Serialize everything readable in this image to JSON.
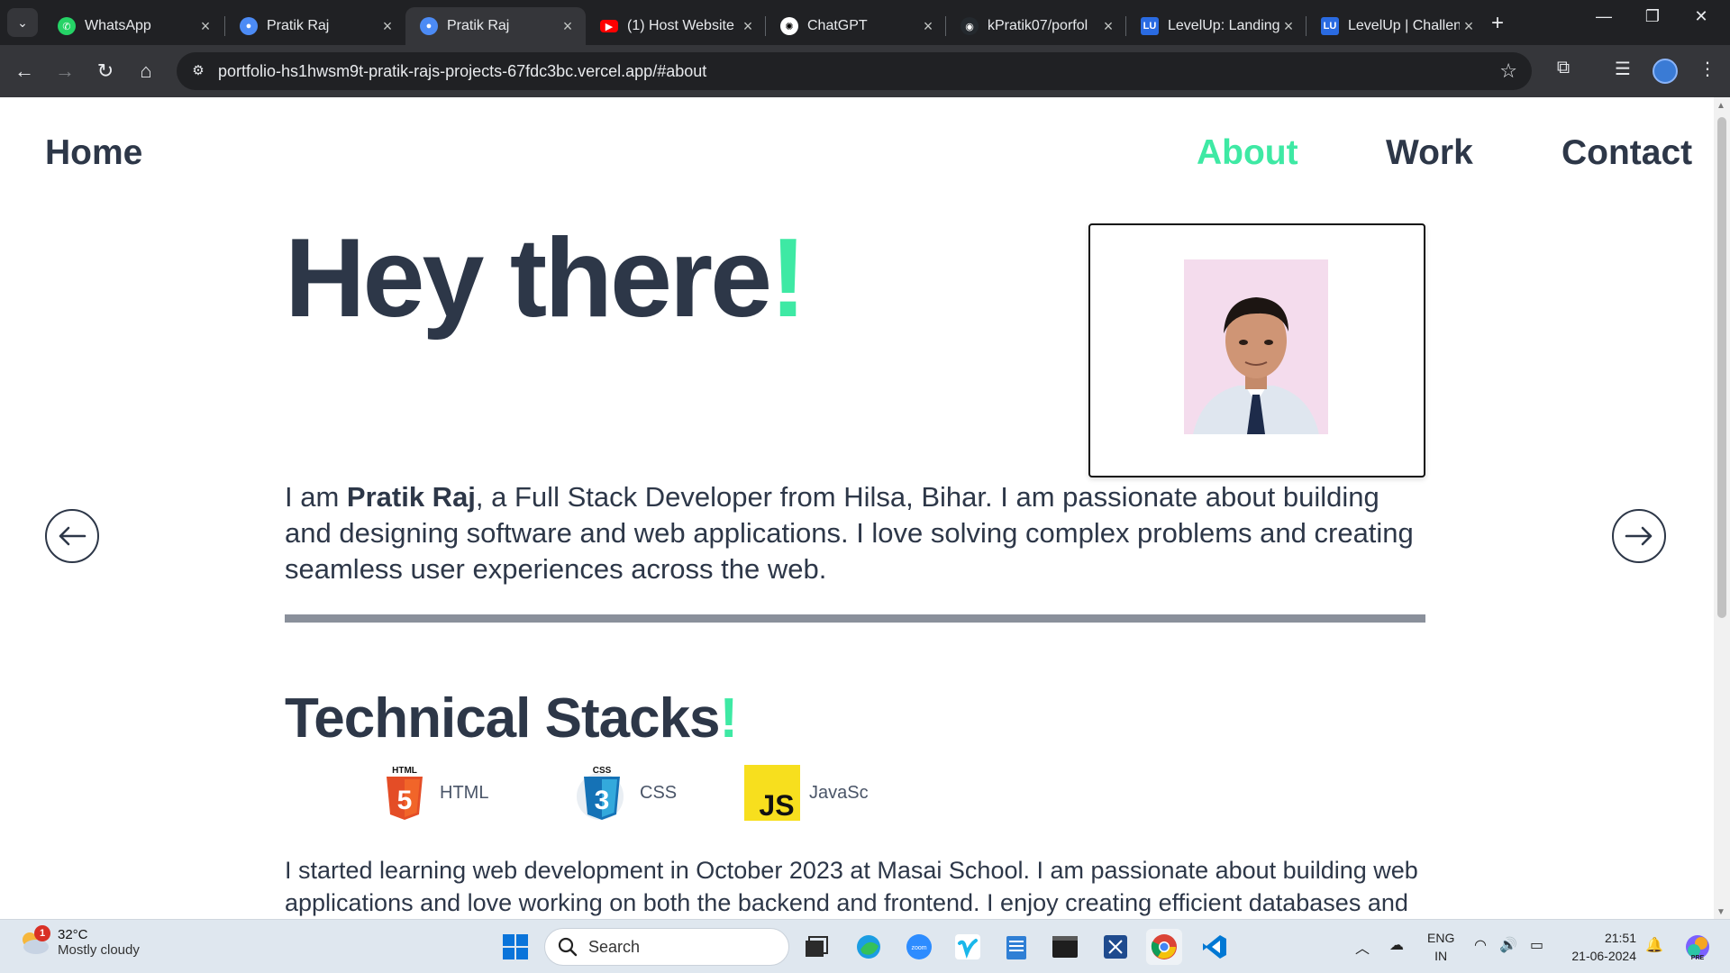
{
  "browser": {
    "tabs": [
      {
        "title": "WhatsApp",
        "icon": "whatsapp-icon",
        "active": false
      },
      {
        "title": "Pratik Raj",
        "icon": "user-icon",
        "active": false
      },
      {
        "title": "Pratik Raj",
        "icon": "user-icon",
        "active": true
      },
      {
        "title": "(1) Host Website",
        "icon": "youtube-icon",
        "active": false
      },
      {
        "title": "ChatGPT",
        "icon": "chatgpt-icon",
        "active": false
      },
      {
        "title": "kPratik07/porfol",
        "icon": "github-icon",
        "active": false
      },
      {
        "title": "LevelUp: Landing",
        "icon": "levelup-icon",
        "active": false
      },
      {
        "title": "LevelUp | Challen",
        "icon": "levelup-icon",
        "active": false
      }
    ],
    "url": "portfolio-hs1hwsm9t-pratik-rajs-projects-67fdc3bc.vercel.app/#about",
    "levelup_badge": "LU"
  },
  "site": {
    "nav": {
      "home": "Home",
      "about": "About",
      "work": "Work",
      "contact": "Contact",
      "active": "About"
    },
    "hero": {
      "title": "Hey there",
      "accent": "!"
    },
    "intro": {
      "prefix": "I am ",
      "name": "Pratik Raj",
      "text": ", a Full Stack Developer from Hilsa, Bihar. I am passionate about building and designing software and web applications. I love solving complex problems and creating seamless user experiences across the web."
    },
    "stacks": {
      "title": "Technical Stacks",
      "accent": "!",
      "items": [
        {
          "label": "HTML",
          "badge": "HTML",
          "glyph": "5",
          "icon": "html5-icon",
          "color": "#e44d26"
        },
        {
          "label": "CSS",
          "badge": "CSS",
          "glyph": "3",
          "icon": "css3-icon",
          "color": "#1572b6"
        },
        {
          "label": "JavaSc",
          "badge": "JS",
          "icon": "javascript-icon",
          "color": "#f7df1e"
        }
      ]
    },
    "paragraph": "I started learning web development in October 2023 at Masai School. I am passionate about building web applications and love working on both the backend and frontend. I enjoy creating efficient databases and",
    "accent_color": "#3ee9a4",
    "text_color": "#2d3748"
  },
  "taskbar": {
    "weather": {
      "temp": "32°C",
      "condition": "Mostly cloudy",
      "badge": "1"
    },
    "search_placeholder": "Search",
    "zoom_label": "zoom",
    "lang": {
      "line1": "ENG",
      "line2": "IN"
    },
    "clock": {
      "time": "21:51",
      "date": "21-06-2024"
    },
    "copilot_badge": "PRE"
  }
}
